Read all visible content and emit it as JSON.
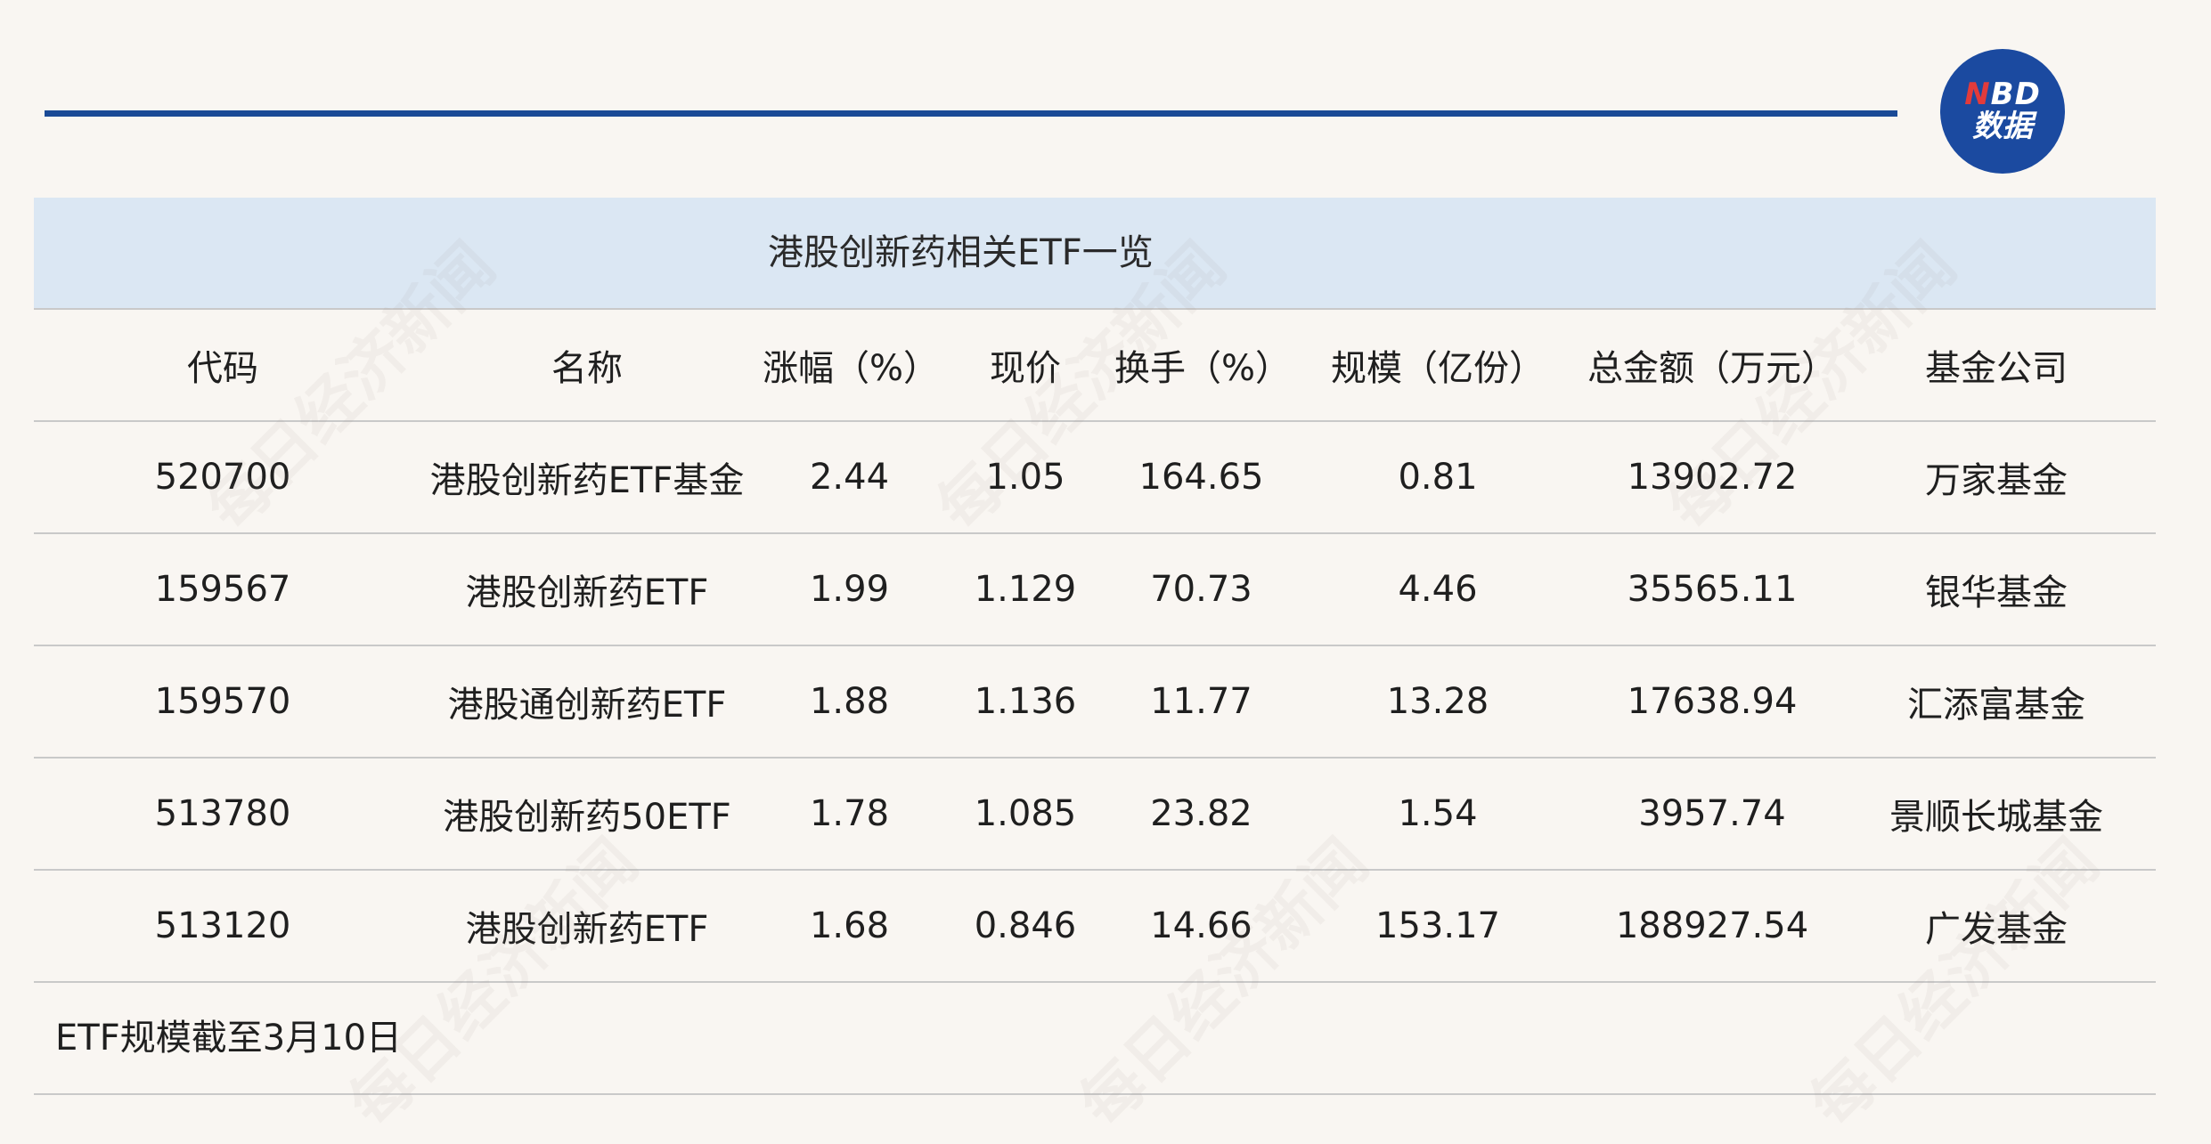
{
  "logo": {
    "line1_n": "N",
    "line1_rest": "BD",
    "line2": "数据"
  },
  "watermark": "每日经济新闻",
  "table": {
    "title": "港股创新药相关ETF一览",
    "headers": [
      "代码",
      "名称",
      "涨幅（%）",
      "现价",
      "换手（%）",
      "规模（亿份）",
      "总金额（万元）",
      "基金公司"
    ],
    "rows": [
      [
        "520700",
        "港股创新药ETF基金",
        "2.44",
        "1.05",
        "164.65",
        "0.81",
        "13902.72",
        "万家基金"
      ],
      [
        "159567",
        "港股创新药ETF",
        "1.99",
        "1.129",
        "70.73",
        "4.46",
        "35565.11",
        "银华基金"
      ],
      [
        "159570",
        "港股通创新药ETF",
        "1.88",
        "1.136",
        "11.77",
        "13.28",
        "17638.94",
        "汇添富基金"
      ],
      [
        "513780",
        "港股创新药50ETF",
        "1.78",
        "1.085",
        "23.82",
        "1.54",
        "3957.74",
        "景顺长城基金"
      ],
      [
        "513120",
        "港股创新药ETF",
        "1.68",
        "0.846",
        "14.66",
        "153.17",
        "188927.54",
        "广发基金"
      ]
    ],
    "note": "ETF规模截至3月10日"
  },
  "colors": {
    "rule": "#1a4a96",
    "title_band": "#dbe7f3",
    "logo": "#1b4aa0",
    "background": "#f9f6f2"
  }
}
